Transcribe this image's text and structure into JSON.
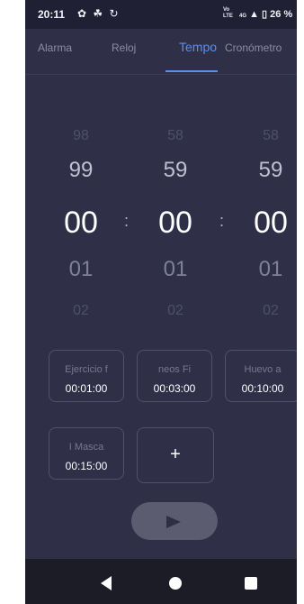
{
  "statusbar": {
    "time": "20:11",
    "icons": "✿ ☘ ↻",
    "network_top": "Vo",
    "network_bottom": "LTE",
    "signal_label": "4G",
    "battery": "26 %"
  },
  "tabs": [
    {
      "label": "Alarma"
    },
    {
      "label": "Reloj"
    },
    {
      "label": "Tempo"
    },
    {
      "label": "Cronómetro"
    }
  ],
  "picker": {
    "hours": {
      "far_prev": "98",
      "prev": "99",
      "current": "00",
      "next": "01",
      "far_next": "02"
    },
    "minutes": {
      "far_prev": "58",
      "prev": "59",
      "current": "00",
      "next": "01",
      "far_next": "02"
    },
    "seconds": {
      "far_prev": "58",
      "prev": "59",
      "current": "00",
      "next": "01",
      "far_next": "02"
    },
    "separator": ":"
  },
  "presets": [
    {
      "name": "Ejercicio f",
      "time": "00:01:00"
    },
    {
      "name": "neos   Fi",
      "time": "00:03:00"
    },
    {
      "name": "Huevo a",
      "time": "00:10:00"
    },
    {
      "name": "I    Masca",
      "time": "00:15:00"
    }
  ],
  "add_label": "+",
  "colors": {
    "background": "#2f3048",
    "accent": "#5f8de8",
    "play_button": "#5b5c70"
  }
}
